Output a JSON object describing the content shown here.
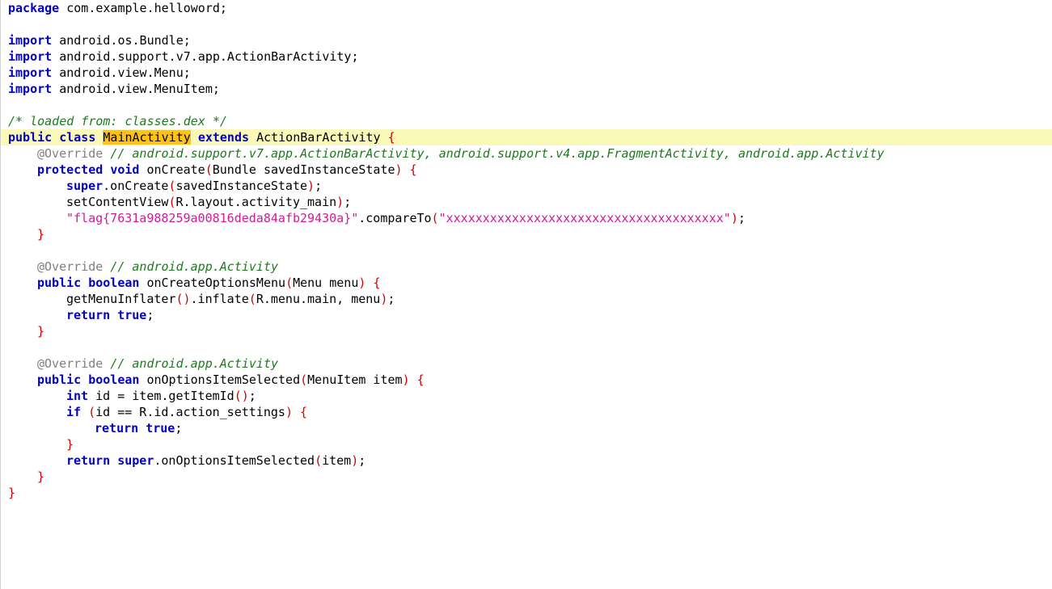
{
  "code": {
    "l1_kw": "package",
    "l1_rest": " com.example.helloword;",
    "import_kw": "import",
    "imports": [
      " android.os.Bundle;",
      " android.support.v7.app.ActionBarActivity;",
      " android.view.Menu;",
      " android.view.MenuItem;"
    ],
    "loaded_comment": "/* loaded from: classes.dex */",
    "class_public": "public",
    "class_kw": "class",
    "class_name": "MainActivity",
    "extends_kw": "extends",
    "super_class": "ActionBarActivity",
    "override": "@Override",
    "m1_comment": "// android.support.v7.app.ActionBarActivity, android.support.v4.app.FragmentActivity, android.app.Activity",
    "m1_protected": "protected",
    "m1_void": "void",
    "m1_name": "onCreate",
    "m1_params": "Bundle savedInstanceState",
    "super_kw": "super",
    "m1_s1_call": ".onCreate",
    "m1_s1_arg": "savedInstanceState",
    "m1_s2": "setContentView",
    "m1_s2_arg": "R.layout.activity_main",
    "flag_string": "\"flag{7631a988259a00816deda84afb29430a}\"",
    "compare_call": ".compareTo",
    "compare_arg": "\"xxxxxxxxxxxxxxxxxxxxxxxxxxxxxxxxxxxxxx\"",
    "m2_comment": "// android.app.Activity",
    "public_kw": "public",
    "boolean_kw": "boolean",
    "m2_name": "onCreateOptionsMenu",
    "m2_params": "Menu menu",
    "m2_s1": "getMenuInflater",
    "m2_s1_b": ".inflate",
    "m2_s1_args": "R.menu.main, menu",
    "return_kw": "return",
    "true_kw": "true",
    "m3_comment": "// android.app.Activity",
    "m3_name": "onOptionsItemSelected",
    "m3_params": "MenuItem item",
    "int_kw": "int",
    "m3_s1": " id = item.getItemId",
    "if_kw": "if",
    "m3_cond": "id == R.id.action_settings",
    "m3_ret_call": ".onOptionsItemSelected",
    "m3_ret_arg": "item",
    "open_brace": "{",
    "close_brace": "}",
    "lparen": "(",
    "rparen": ")",
    "semi": ";",
    "empty_parens": "()"
  }
}
